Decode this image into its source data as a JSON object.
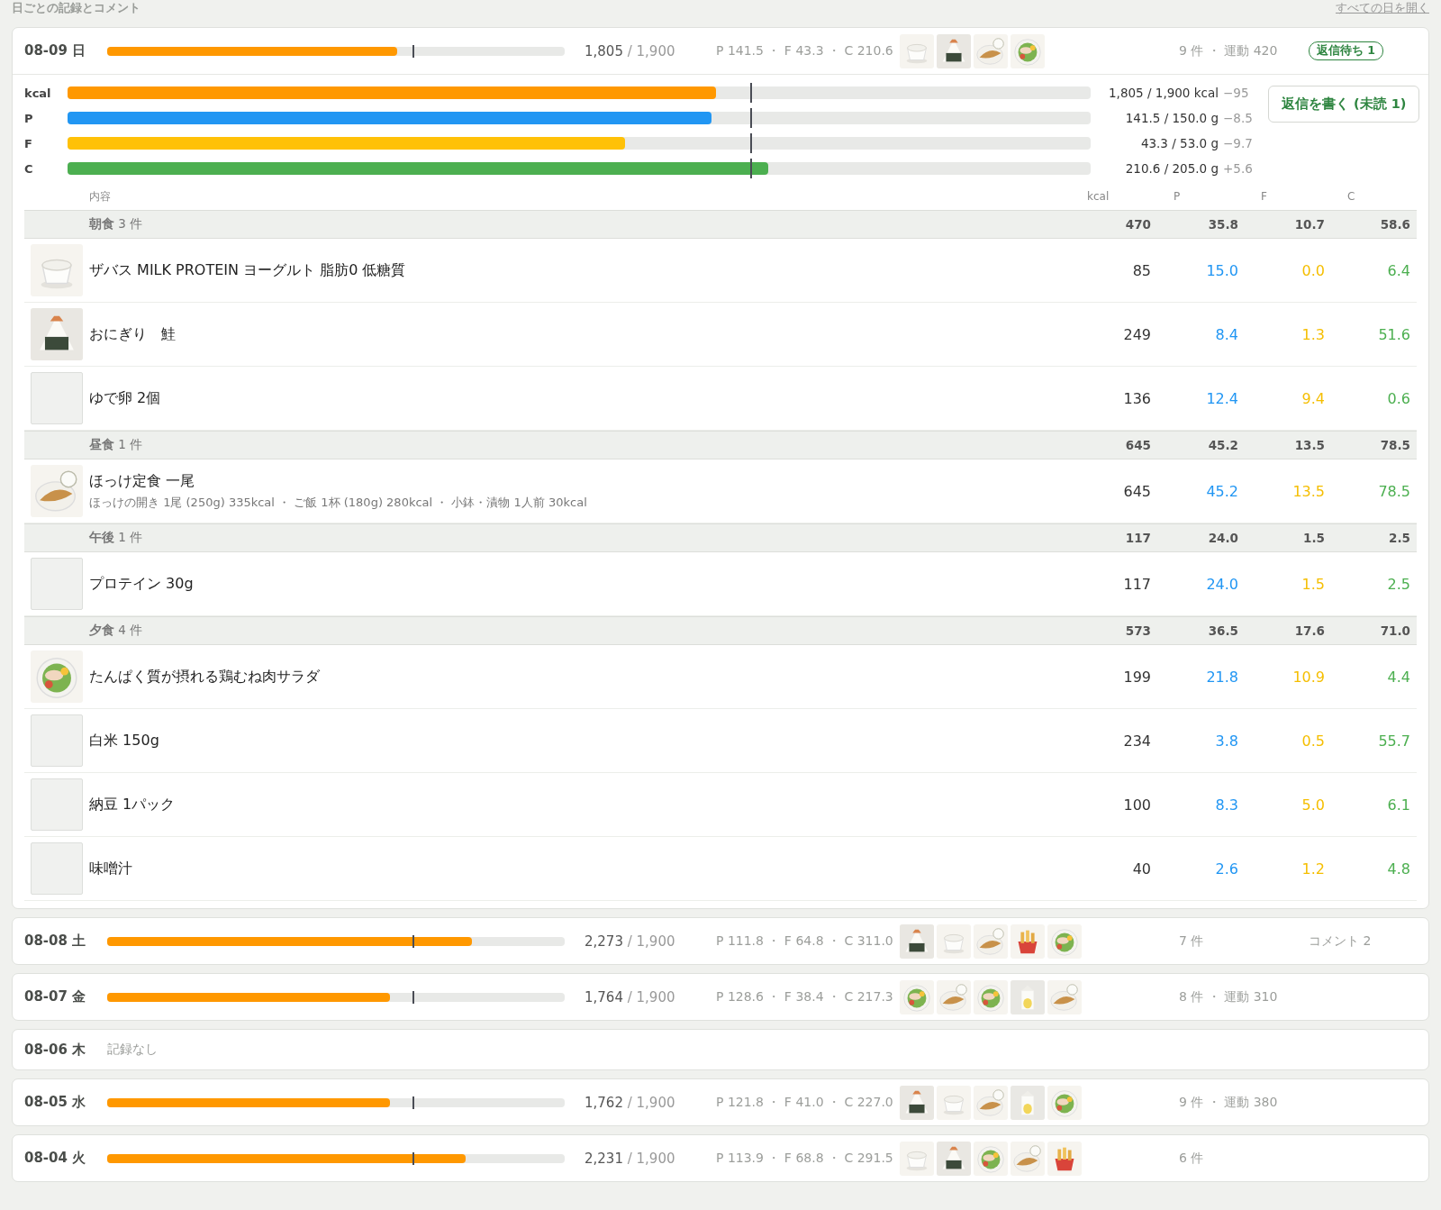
{
  "section_title": "日ごとの記録とコメント",
  "open_all_link": "すべての日を開く",
  "days": [
    {
      "date": "08-09 日",
      "expanded": true,
      "level": 0.633,
      "kcal": "1,805",
      "target": "/ 1,900",
      "pfc": "P 141.5 ・ F 43.3 ・ C 210.6",
      "photos": [
        {
          "kind": "cup"
        },
        {
          "kind": "onigiri"
        },
        {
          "kind": "plate"
        },
        {
          "kind": "salad"
        }
      ],
      "summary": "9 件 ・ 運動 420",
      "badge": "返信待ち 1",
      "details": {
        "macros": [
          {
            "label": "kcal",
            "kind": "kcal",
            "level": 0.634,
            "value": "1,805 / 1,900 kcal",
            "delta": "−95"
          },
          {
            "label": "P",
            "kind": "protein",
            "level": 0.629,
            "value": "141.5 / 150.0 g",
            "delta": "−8.5"
          },
          {
            "label": "F",
            "kind": "fat",
            "level": 0.545,
            "value": "43.3 / 53.0 g",
            "delta": "−9.7"
          },
          {
            "label": "C",
            "kind": "carb",
            "level": 0.685,
            "value": "210.6 / 205.0 g",
            "delta": "+5.6"
          }
        ],
        "reply_button": "返信を書く (未読 1)",
        "columns": [
          "内容",
          "kcal",
          "P",
          "F",
          "C"
        ],
        "groups": [
          {
            "name": "朝食",
            "count": "3 件",
            "kcal": "470",
            "p": "35.8",
            "f": "10.7",
            "c": "58.6",
            "items": [
              {
                "name": "ザバス MILK PROTEIN ヨーグルト 脂肪0 低糖質",
                "kind": "cup",
                "kcal": "85",
                "p": "15.0",
                "f": "0.0",
                "c": "6.4"
              },
              {
                "name": "おにぎり　鮭",
                "kind": "onigiri",
                "kcal": "249",
                "p": "8.4",
                "f": "1.3",
                "c": "51.6"
              },
              {
                "name": "ゆで卵 2個",
                "kind": "none",
                "kcal": "136",
                "p": "12.4",
                "f": "9.4",
                "c": "0.6"
              }
            ]
          },
          {
            "name": "昼食",
            "count": "1 件",
            "kcal": "645",
            "p": "45.2",
            "f": "13.5",
            "c": "78.5",
            "items": [
              {
                "name": "ほっけ定食 一尾",
                "note": "ほっけの開き 1尾 (250g) 335kcal ・ ご飯 1杯 (180g) 280kcal ・ 小鉢・漬物 1人前 30kcal",
                "kind": "plate",
                "kcal": "645",
                "p": "45.2",
                "f": "13.5",
                "c": "78.5"
              }
            ]
          },
          {
            "name": "午後",
            "count": "1 件",
            "kcal": "117",
            "p": "24.0",
            "f": "1.5",
            "c": "2.5",
            "items": [
              {
                "name": "プロテイン 30g",
                "kind": "none",
                "kcal": "117",
                "p": "24.0",
                "f": "1.5",
                "c": "2.5"
              }
            ]
          },
          {
            "name": "夕食",
            "count": "4 件",
            "kcal": "573",
            "p": "36.5",
            "f": "17.6",
            "c": "71.0",
            "items": [
              {
                "name": "たんぱく質が摂れる鶏むね肉サラダ",
                "kind": "salad",
                "kcal": "199",
                "p": "21.8",
                "f": "10.9",
                "c": "4.4"
              },
              {
                "name": "白米 150g",
                "kind": "none",
                "kcal": "234",
                "p": "3.8",
                "f": "0.5",
                "c": "55.7"
              },
              {
                "name": "納豆 1パック",
                "kind": "none",
                "kcal": "100",
                "p": "8.3",
                "f": "5.0",
                "c": "6.1"
              },
              {
                "name": "味噌汁",
                "kind": "none",
                "kcal": "40",
                "p": "2.6",
                "f": "1.2",
                "c": "4.8"
              }
            ]
          }
        ]
      }
    },
    {
      "date": "08-08 土",
      "expanded": false,
      "level": 0.797,
      "kcal": "2,273",
      "target": "/ 1,900",
      "pfc": "P 111.8 ・ F 64.8 ・ C 311.0",
      "photos": [
        {
          "kind": "onigiri"
        },
        {
          "kind": "cup"
        },
        {
          "kind": "plate"
        },
        {
          "kind": "fries"
        },
        {
          "kind": "salad"
        }
      ],
      "summary": "7 件",
      "comment": "コメント 2"
    },
    {
      "date": "08-07 金",
      "expanded": false,
      "level": 0.619,
      "kcal": "1,764",
      "target": "/ 1,900",
      "pfc": "P 128.6 ・ F 38.4 ・ C 217.3",
      "photos": [
        {
          "kind": "salad"
        },
        {
          "kind": "plate"
        },
        {
          "kind": "salad"
        },
        {
          "kind": "carton"
        },
        {
          "kind": "plate"
        }
      ],
      "summary": "8 件 ・ 運動 310"
    },
    {
      "date": "08-06 木",
      "expanded": false,
      "note": "記録なし"
    },
    {
      "date": "08-05 水",
      "expanded": false,
      "level": 0.618,
      "kcal": "1,762",
      "target": "/ 1,900",
      "pfc": "P 121.8 ・ F 41.0 ・ C 227.0",
      "photos": [
        {
          "kind": "onigiri"
        },
        {
          "kind": "cup"
        },
        {
          "kind": "plate"
        },
        {
          "kind": "carton"
        },
        {
          "kind": "salad"
        }
      ],
      "summary": "9 件 ・ 運動 380"
    },
    {
      "date": "08-04 火",
      "expanded": false,
      "level": 0.783,
      "kcal": "2,231",
      "target": "/ 1,900",
      "pfc": "P 113.9 ・ F 68.8 ・ C 291.5",
      "photos": [
        {
          "kind": "cup"
        },
        {
          "kind": "onigiri"
        },
        {
          "kind": "salad"
        },
        {
          "kind": "plate"
        },
        {
          "kind": "fries"
        }
      ],
      "summary": "6 件"
    }
  ]
}
